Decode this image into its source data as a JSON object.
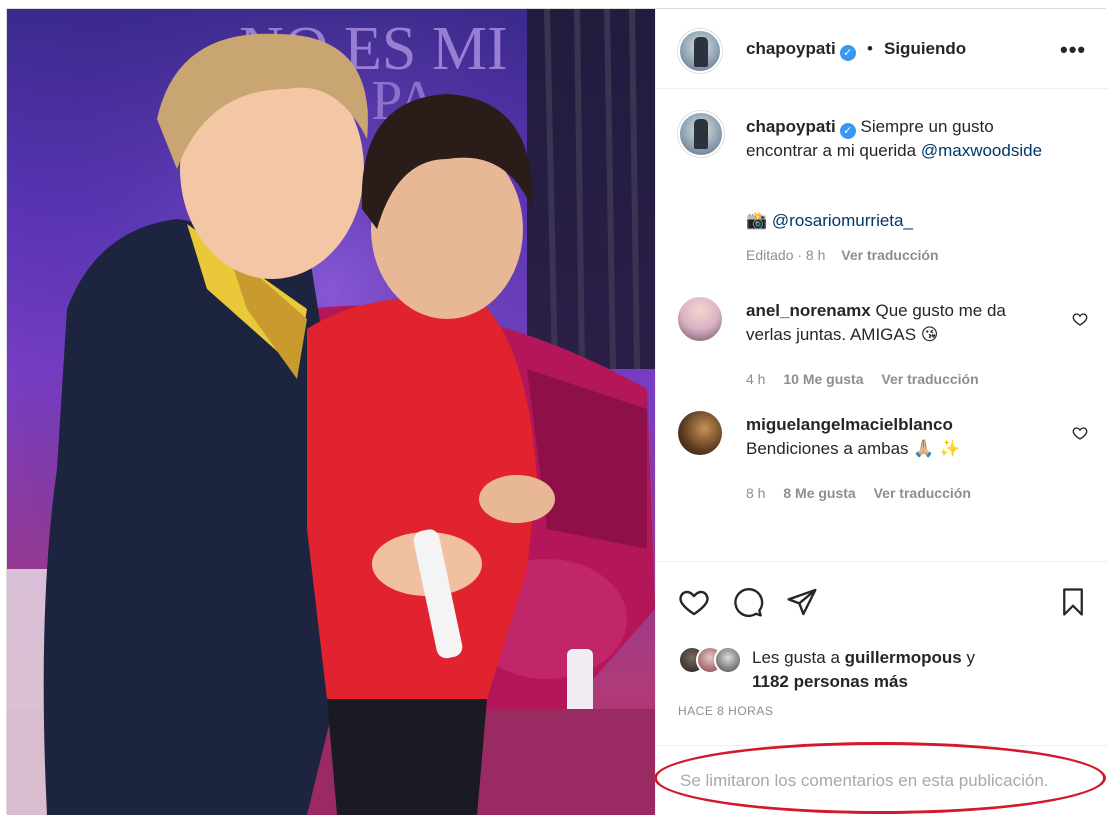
{
  "post": {
    "username": "chapoypati",
    "verified_icon": "verified-badge-icon",
    "separator": "•",
    "follow_status": "Siguiendo",
    "more_label": "•••"
  },
  "photo": {
    "backdrop_text_line1": "NO ES MI",
    "backdrop_text_line2": "LPA"
  },
  "caption": {
    "username": "chapoypati",
    "text": "Siempre un gusto encontrar a mi querida",
    "mention": "@maxwoodside",
    "camera_emoji": "📸",
    "photo_credit": "@rosariomurrieta_",
    "edited": "Editado · 8 h",
    "translate": "Ver traducción"
  },
  "comments": [
    {
      "username": "anel_norenamx",
      "text": "Que gusto me da verlas juntas. AMIGAS 😘",
      "time": "4 h",
      "likes": "10 Me gusta",
      "translate": "Ver traducción"
    },
    {
      "username": "miguelangelmacielblanco",
      "text": "Bendiciones a ambas 🙏🏼 ✨",
      "time": "8 h",
      "likes": "8 Me gusta",
      "translate": "Ver traducción"
    }
  ],
  "likes": {
    "prefix": "Les gusta a",
    "user": "guillermopous",
    "conj": "y",
    "others": "1182 personas más"
  },
  "timestamp": "HACE 8 HORAS",
  "comments_limited": "Se limitaron los comentarios en esta publicación.",
  "colors": {
    "text": "#262626",
    "secondary": "#8e8e8e",
    "link": "#00376b",
    "verified": "#3897f0",
    "annotation": "#d11a2a"
  }
}
